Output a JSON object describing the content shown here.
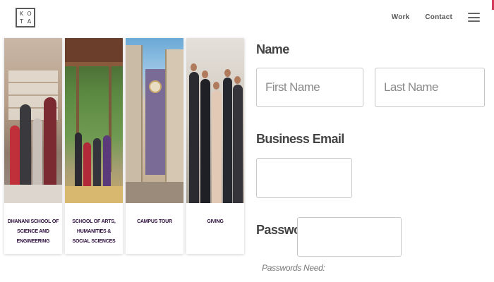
{
  "header": {
    "logo_letters": [
      "K",
      "O",
      "T",
      "A"
    ],
    "nav": [
      {
        "label": "Work"
      },
      {
        "label": "Contact"
      }
    ],
    "menu_icon": "hamburger-menu-icon",
    "accent_color": "#d33b5a"
  },
  "cards": [
    {
      "label": "Dhanani School of Science and Engineering"
    },
    {
      "label": "School of Arts, Humanities & Social Sciences"
    },
    {
      "label": "Campus Tour"
    },
    {
      "label": "Giving"
    }
  ],
  "form": {
    "name_label": "Name",
    "first_name_placeholder": "First Name",
    "last_name_placeholder": "Last Name",
    "email_label": "Business Email",
    "email_placeholder": "",
    "password_label": "Password",
    "password_placeholder": "",
    "password_hint": "Passwords Need:"
  }
}
